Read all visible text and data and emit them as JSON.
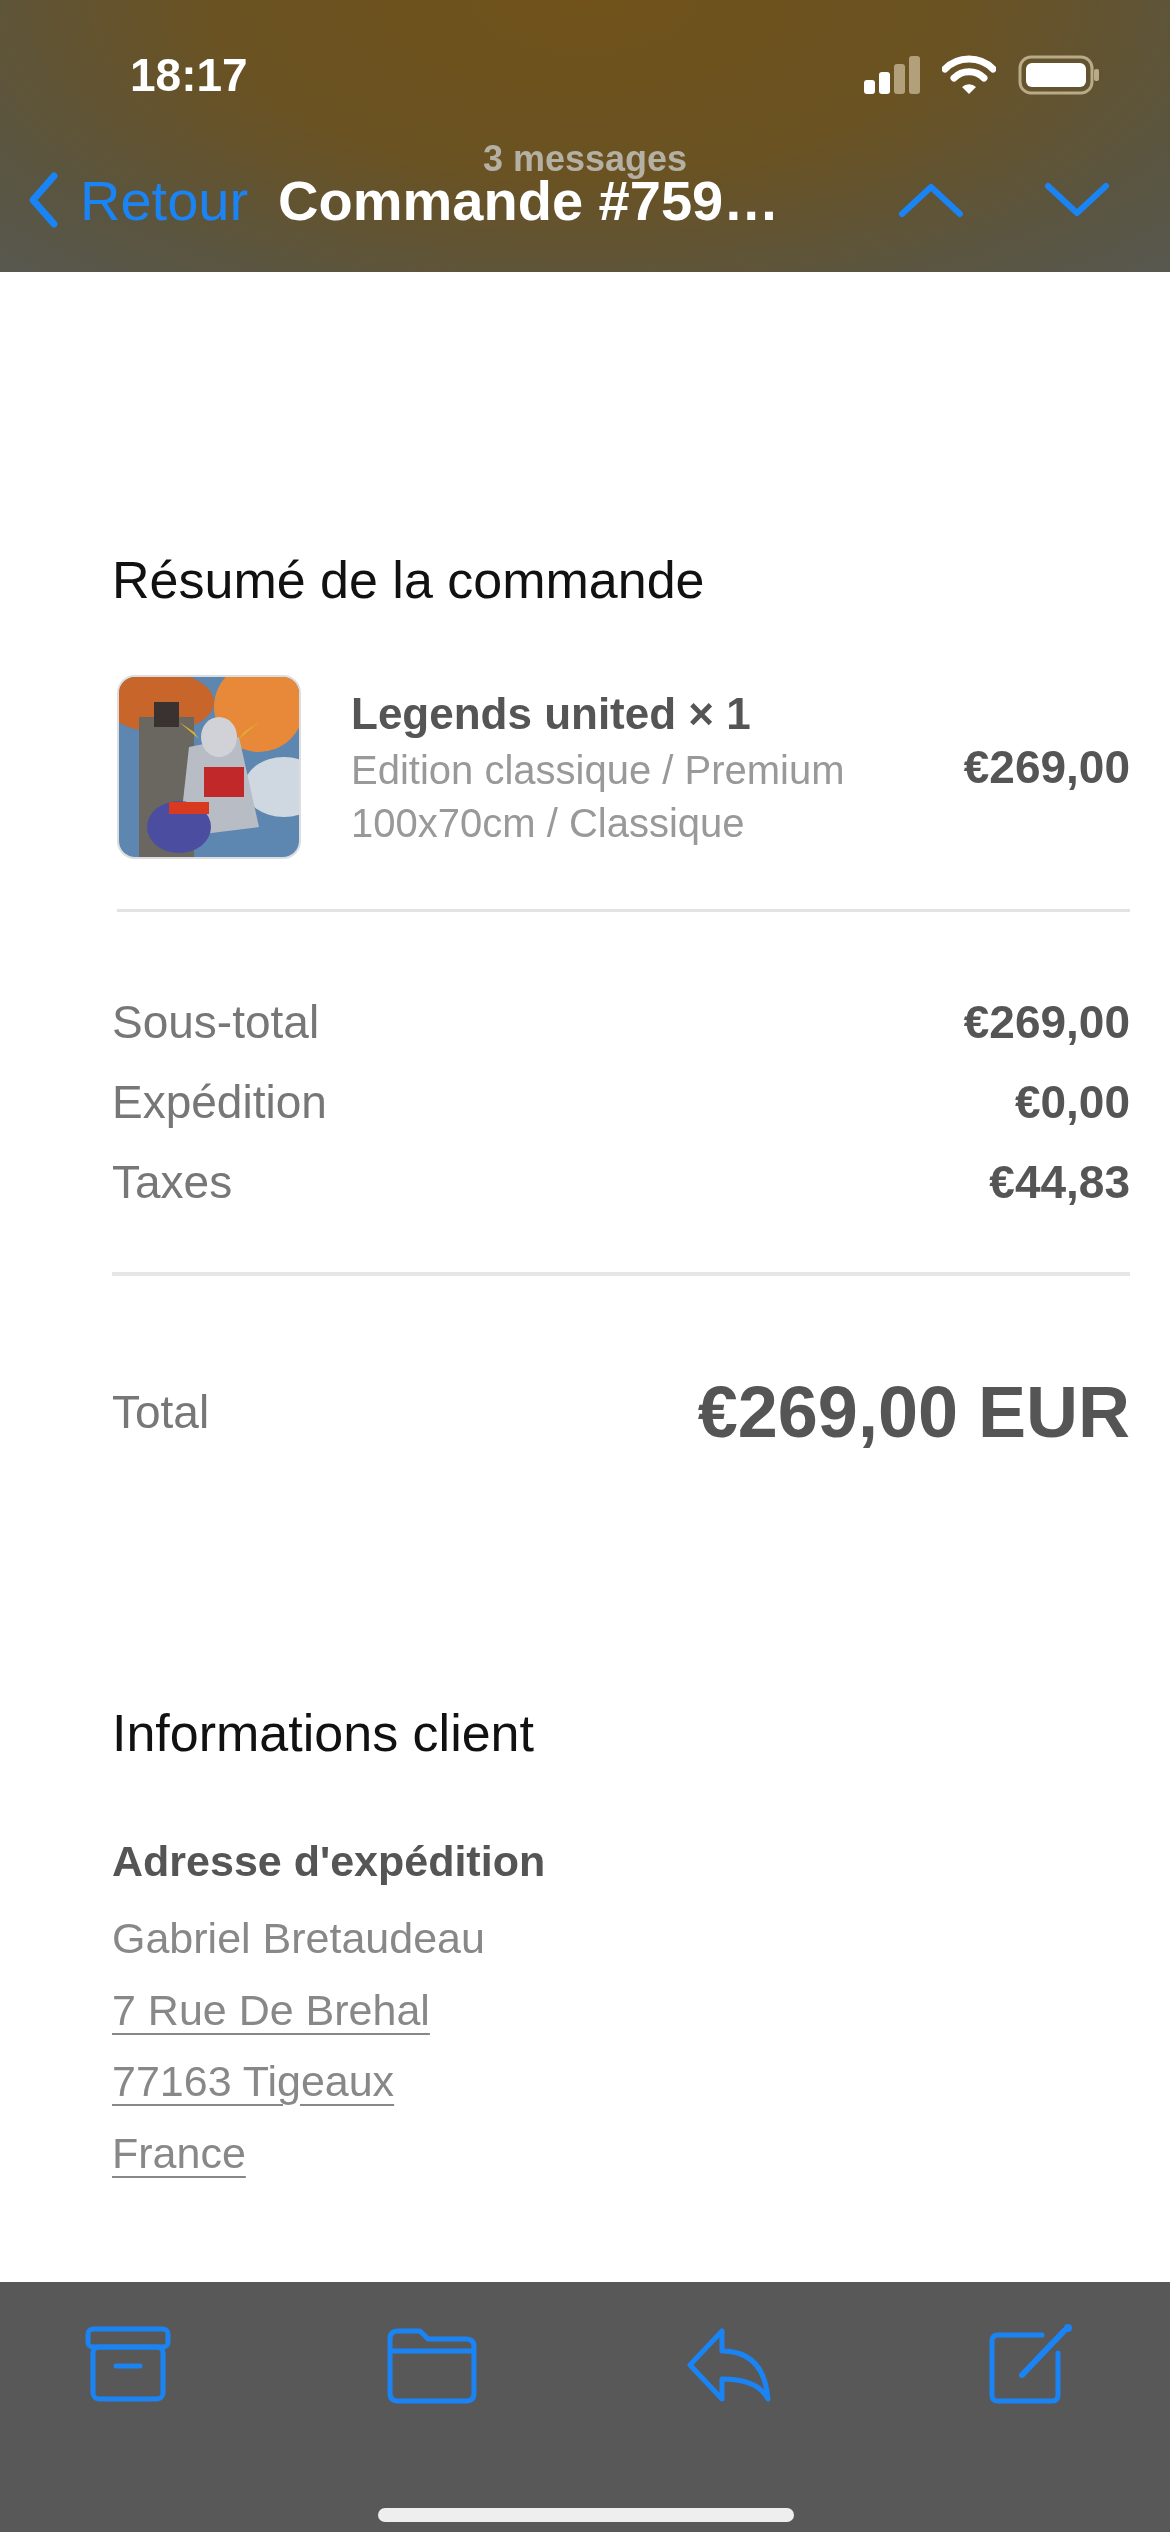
{
  "status_bar": {
    "time": "18:17"
  },
  "nav": {
    "back": "Retour",
    "subtitle": "3 messages",
    "title": "Commande #759…"
  },
  "order_summary": {
    "heading": "Résumé de la commande",
    "items": [
      {
        "title": "Legends united × 1",
        "variant_lines": [
          "Edition classique / Premium",
          "100x70cm / Classique"
        ],
        "price": "€269,00"
      }
    ],
    "lines": [
      {
        "label": "Sous-total",
        "value": "€269,00"
      },
      {
        "label": "Expédition",
        "value": "€0,00"
      },
      {
        "label": "Taxes",
        "value": "€44,83"
      }
    ],
    "total": {
      "label": "Total",
      "value": "€269,00 EUR"
    }
  },
  "customer": {
    "heading": "Informations client",
    "address_heading": "Adresse d'expédition",
    "address_lines": [
      {
        "text": "Gabriel Bretaudeau",
        "linked": false
      },
      {
        "text": "7 Rue De Brehal",
        "linked": true
      },
      {
        "text": "77163 Tigeaux",
        "linked": true
      },
      {
        "text": "France",
        "linked": true
      }
    ]
  },
  "toolbar": [
    {
      "kind": "archive"
    },
    {
      "kind": "folder"
    },
    {
      "kind": "reply"
    },
    {
      "kind": "compose"
    }
  ]
}
